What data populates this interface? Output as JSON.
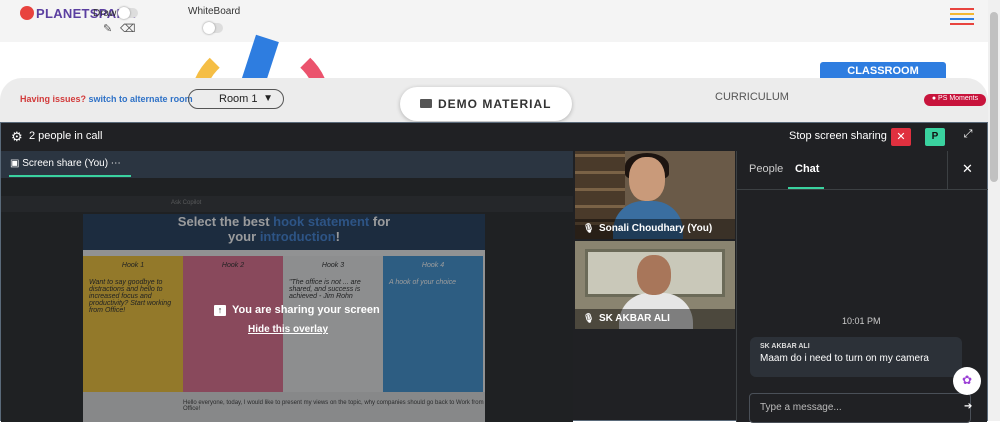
{
  "header": {
    "logo": "PLANETSPARK",
    "draw_label": "Draw",
    "whiteboard_label": "WhiteBoard",
    "menu_colors": [
      "#e8433e",
      "#f5b731",
      "#2e7de0",
      "#e8433e"
    ]
  },
  "nav": {
    "issue_text": "Having issues?",
    "issue_link": "switch to alternate room",
    "room_label": "Room 1",
    "demo_material": "DEMO MATERIAL",
    "curriculum": "CURRICULUM",
    "classroom": "CLASSROOM",
    "moments": "PS Moments"
  },
  "meet": {
    "people_in_call": "2 people in call",
    "stop_sharing": "Stop screen sharing",
    "p_badge": "P",
    "screen_share_tab": "Screen share (You)",
    "overlay_text": "You are sharing your screen",
    "overlay_link": "Hide this overlay"
  },
  "slide": {
    "toolbar_text": "Ask Copilot",
    "title_a": "Select the best ",
    "title_b": "hook statement",
    "title_c": " for",
    "title_d": "your ",
    "title_e": "introduction",
    "title_f": "!",
    "hooks": [
      {
        "title": "Hook 1",
        "text": "Want to say goodbye to distractions and hello to increased focus and productivity? Start working from Office!",
        "color": "#f2c230"
      },
      {
        "title": "Hook 2",
        "text": "",
        "color": "#e06a8a"
      },
      {
        "title": "Hook 3",
        "text": "\"The office is not ... are shared, and success is achieved - Jim Rohn",
        "color": "#e8e8e8"
      },
      {
        "title": "Hook 4",
        "text": "A hook of your choice",
        "color": "#3a8fd0"
      }
    ],
    "bottom_text": "Hello everyone, today, I would like to present my views on the topic, why companies should go back to Work from Office!"
  },
  "participants": [
    {
      "name": "Sonali Choudhary (You)"
    },
    {
      "name": "SK AKBAR ALI"
    }
  ],
  "sidebar": {
    "tab_people": "People",
    "tab_chat": "Chat",
    "time": "10:01 PM",
    "message_from": "SK AKBAR ALI",
    "message_text": "Maam do i need to turn on my camera",
    "input_placeholder": "Type a message..."
  }
}
